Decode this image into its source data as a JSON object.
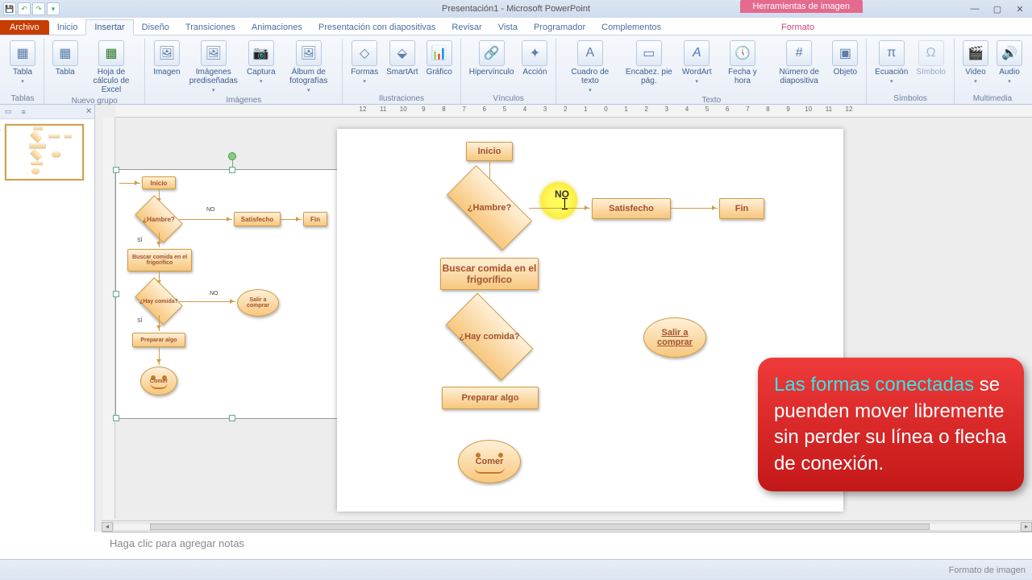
{
  "title": "Presentación1 - Microsoft PowerPoint",
  "contextual_tab": "Herramientas de imagen",
  "tabs": {
    "file": "Archivo",
    "home": "Inicio",
    "insert": "Insertar",
    "design": "Diseño",
    "transitions": "Transiciones",
    "animations": "Animaciones",
    "slideshow": "Presentación con diapositivas",
    "review": "Revisar",
    "view": "Vista",
    "developer": "Programador",
    "addins": "Complementos",
    "format": "Formato"
  },
  "ribbon": {
    "groups": {
      "tables": "Tablas",
      "newgroup": "Nuevo grupo",
      "images": "Imágenes",
      "illustrations": "Ilustraciones",
      "links": "Vínculos",
      "text": "Texto",
      "symbols": "Símbolos",
      "media": "Multimedia"
    },
    "buttons": {
      "table": "Tabla",
      "excel_table": "Tabla",
      "excel_sheet": "Hoja de cálculo de Excel",
      "image": "Imagen",
      "clipart": "Imágenes prediseñadas",
      "screenshot": "Captura",
      "photo_album": "Álbum de fotografías",
      "shapes": "Formas",
      "smartart": "SmartArt",
      "chart": "Gráfico",
      "hyperlink": "Hipervínculo",
      "action": "Acción",
      "textbox": "Cuadro de texto",
      "header_footer": "Encabez. pie pág.",
      "wordart": "WordArt",
      "datetime": "Fecha y hora",
      "slide_number": "Número de diapositiva",
      "object": "Objeto",
      "equation": "Ecuación",
      "symbol": "Símbolo",
      "video": "Video",
      "audio": "Audio"
    }
  },
  "ruler_labels": [
    "12",
    "11",
    "10",
    "9",
    "8",
    "7",
    "6",
    "5",
    "4",
    "3",
    "2",
    "1",
    "0",
    "1",
    "2",
    "3",
    "4",
    "5",
    "6",
    "7",
    "8",
    "9",
    "10",
    "11",
    "12"
  ],
  "flow": {
    "start": "Inicio",
    "hungry": "¿Hambre?",
    "satisfied": "Satisfecho",
    "end": "Fin",
    "search_food": "Buscar comida en el frigorífico",
    "any_food": "¿Hay comida?",
    "go_shopping": "Salir a comprar",
    "prepare": "Preparar algo",
    "eat": "Comer",
    "no": "NO",
    "yes": "SÍ"
  },
  "callout": {
    "line1": "Las formas conectadas",
    "line2": " se puenden mover libremente sin perder su línea o flecha de conexión."
  },
  "notes_placeholder": "Haga clic para agregar notas",
  "status": {
    "right": "Formato de imagen"
  }
}
